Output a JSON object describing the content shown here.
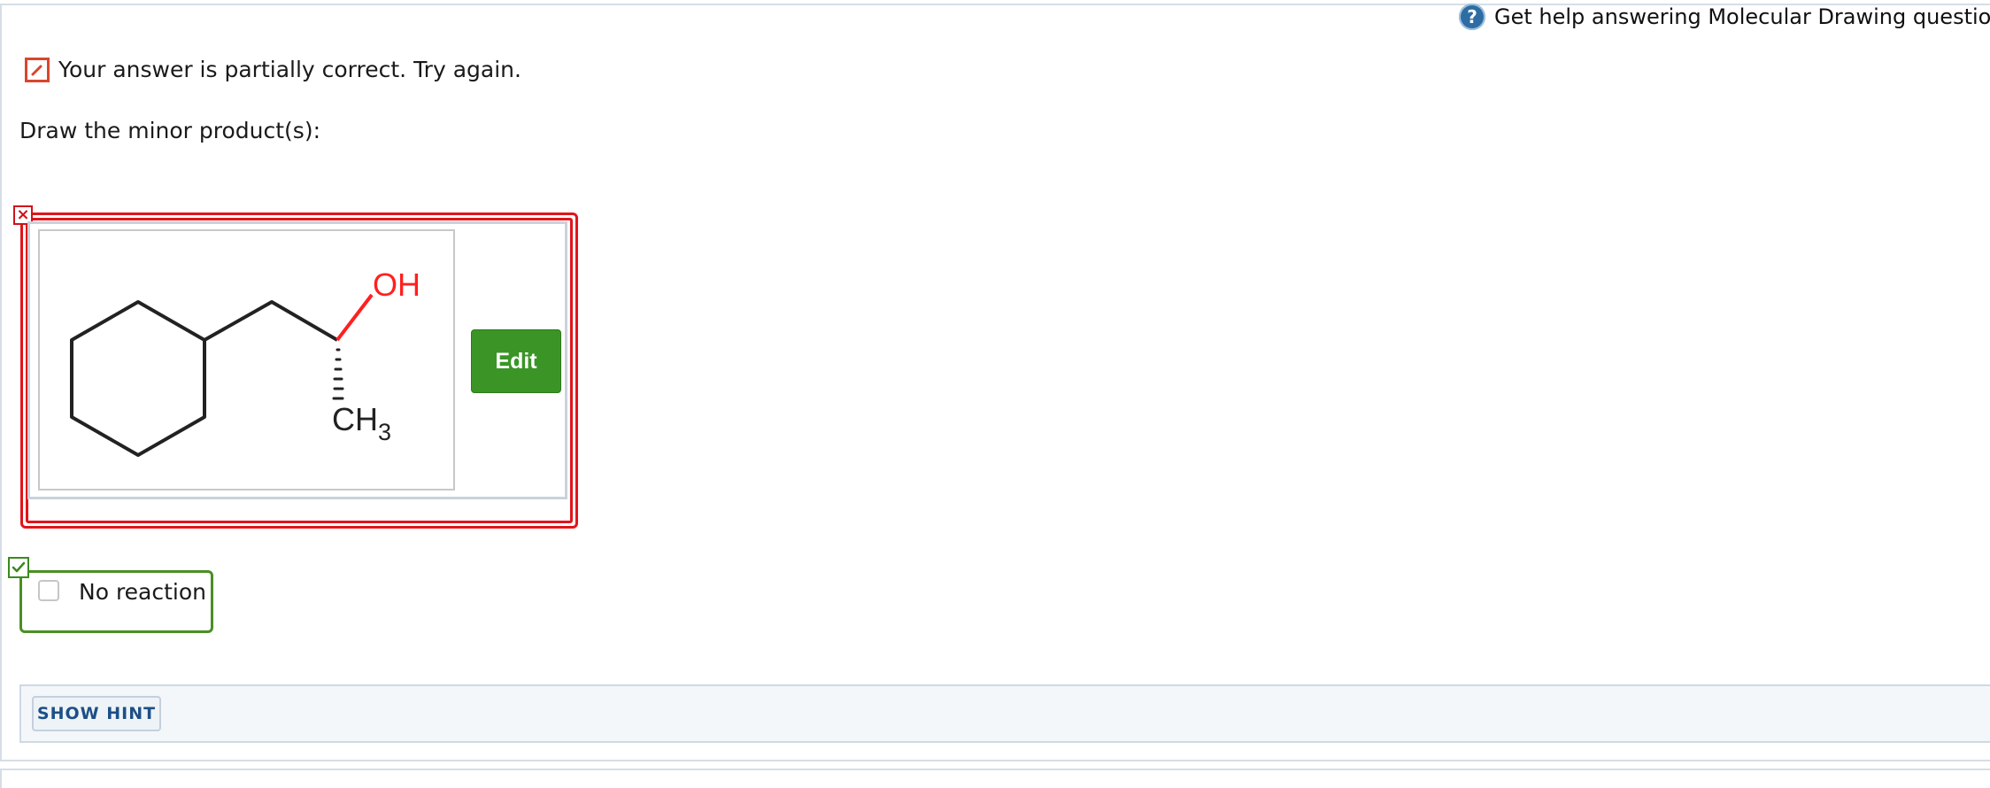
{
  "help": {
    "icon": "question-circle-icon",
    "text": "Get help answering Molecular Drawing questions"
  },
  "feedback": {
    "icon": "pencil-icon",
    "text": "Your answer is partially correct.  Try again."
  },
  "prompt": "Draw the minor product(s):",
  "drawing": {
    "status_icon": "x-mark-icon",
    "molecule": {
      "oh_label": "OH",
      "ch3_label": "CH",
      "ch3_subscript": "3"
    },
    "edit_label": "Edit"
  },
  "no_reaction": {
    "status_icon": "checkmark-icon",
    "label": "No reaction",
    "checked": false
  },
  "hint": {
    "button_label": "SHOW HINT"
  },
  "colors": {
    "error": "#e0151b",
    "success": "#4a8f25",
    "edit_button": "#3a9526",
    "hint_text": "#1d4f86",
    "oh": "#ff2020"
  }
}
